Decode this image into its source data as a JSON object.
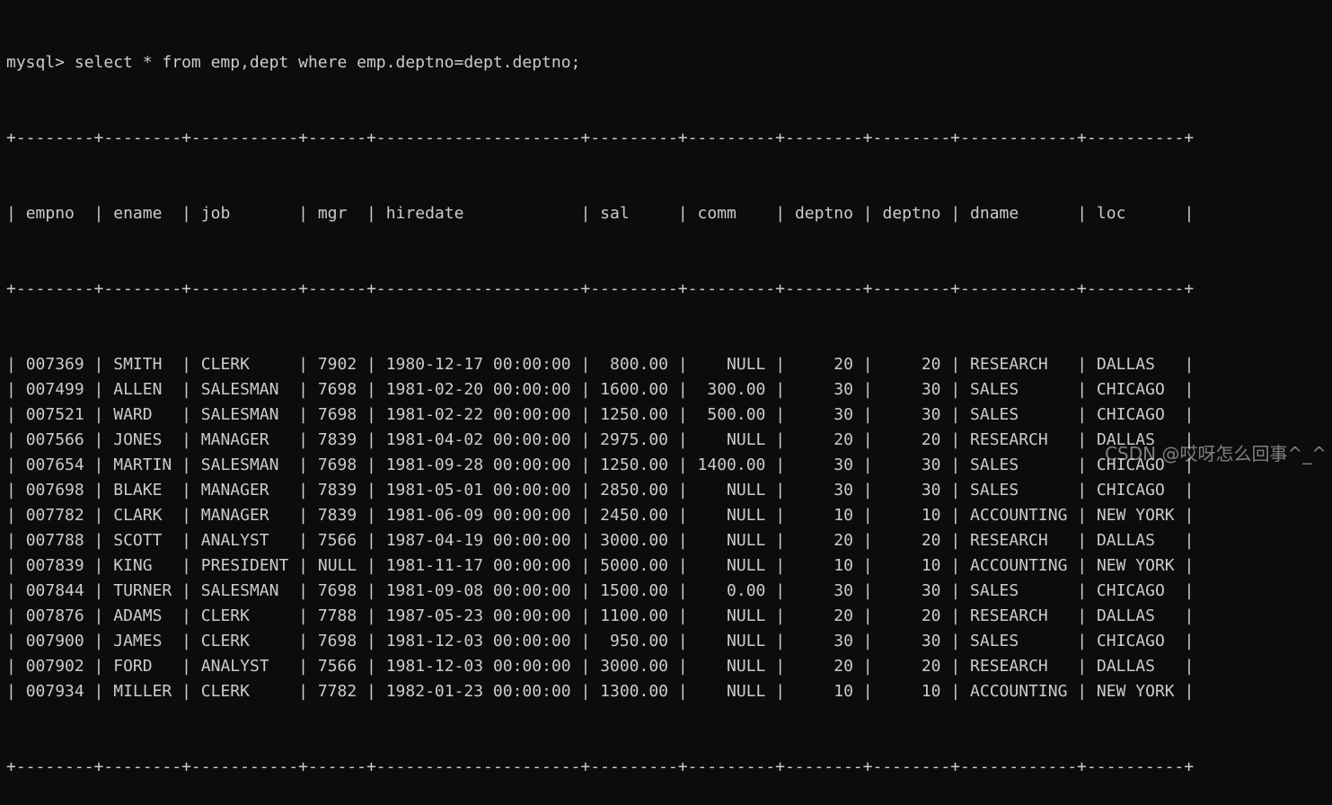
{
  "terminal": {
    "prompt": "mysql> ",
    "command": "select * from emp,dept where emp.deptno=dept.deptno;",
    "text_color": "#cccccc",
    "background": "#0c0c0c"
  },
  "result": {
    "columns": [
      "empno",
      "ename",
      "job",
      "mgr",
      "hiredate",
      "sal",
      "comm",
      "deptno",
      "deptno",
      "dname",
      "loc"
    ],
    "align": [
      "left",
      "left",
      "left",
      "left",
      "left",
      "right",
      "right",
      "right",
      "right",
      "left",
      "left"
    ],
    "rows": [
      [
        "007369",
        "SMITH",
        "CLERK",
        "7902",
        "1980-12-17 00:00:00",
        "800.00",
        "NULL",
        "20",
        "20",
        "RESEARCH",
        "DALLAS"
      ],
      [
        "007499",
        "ALLEN",
        "SALESMAN",
        "7698",
        "1981-02-20 00:00:00",
        "1600.00",
        "300.00",
        "30",
        "30",
        "SALES",
        "CHICAGO"
      ],
      [
        "007521",
        "WARD",
        "SALESMAN",
        "7698",
        "1981-02-22 00:00:00",
        "1250.00",
        "500.00",
        "30",
        "30",
        "SALES",
        "CHICAGO"
      ],
      [
        "007566",
        "JONES",
        "MANAGER",
        "7839",
        "1981-04-02 00:00:00",
        "2975.00",
        "NULL",
        "20",
        "20",
        "RESEARCH",
        "DALLAS"
      ],
      [
        "007654",
        "MARTIN",
        "SALESMAN",
        "7698",
        "1981-09-28 00:00:00",
        "1250.00",
        "1400.00",
        "30",
        "30",
        "SALES",
        "CHICAGO"
      ],
      [
        "007698",
        "BLAKE",
        "MANAGER",
        "7839",
        "1981-05-01 00:00:00",
        "2850.00",
        "NULL",
        "30",
        "30",
        "SALES",
        "CHICAGO"
      ],
      [
        "007782",
        "CLARK",
        "MANAGER",
        "7839",
        "1981-06-09 00:00:00",
        "2450.00",
        "NULL",
        "10",
        "10",
        "ACCOUNTING",
        "NEW YORK"
      ],
      [
        "007788",
        "SCOTT",
        "ANALYST",
        "7566",
        "1987-04-19 00:00:00",
        "3000.00",
        "NULL",
        "20",
        "20",
        "RESEARCH",
        "DALLAS"
      ],
      [
        "007839",
        "KING",
        "PRESIDENT",
        "NULL",
        "1981-11-17 00:00:00",
        "5000.00",
        "NULL",
        "10",
        "10",
        "ACCOUNTING",
        "NEW YORK"
      ],
      [
        "007844",
        "TURNER",
        "SALESMAN",
        "7698",
        "1981-09-08 00:00:00",
        "1500.00",
        "0.00",
        "30",
        "30",
        "SALES",
        "CHICAGO"
      ],
      [
        "007876",
        "ADAMS",
        "CLERK",
        "7788",
        "1987-05-23 00:00:00",
        "1100.00",
        "NULL",
        "20",
        "20",
        "RESEARCH",
        "DALLAS"
      ],
      [
        "007900",
        "JAMES",
        "CLERK",
        "7698",
        "1981-12-03 00:00:00",
        "950.00",
        "NULL",
        "30",
        "30",
        "SALES",
        "CHICAGO"
      ],
      [
        "007902",
        "FORD",
        "ANALYST",
        "7566",
        "1981-12-03 00:00:00",
        "3000.00",
        "NULL",
        "20",
        "20",
        "RESEARCH",
        "DALLAS"
      ],
      [
        "007934",
        "MILLER",
        "CLERK",
        "7782",
        "1982-01-23 00:00:00",
        "1300.00",
        "NULL",
        "10",
        "10",
        "ACCOUNTING",
        "NEW YORK"
      ]
    ]
  },
  "watermark": "CSDN @哎呀怎么回事^_^"
}
